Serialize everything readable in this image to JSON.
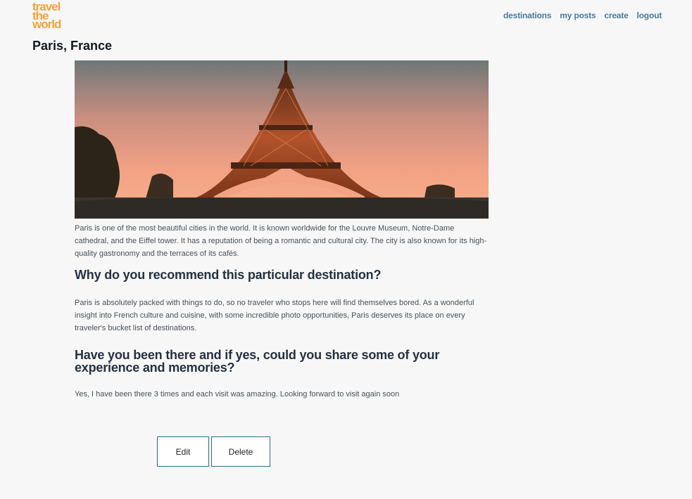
{
  "logo": {
    "line1": "travel",
    "line2": "the",
    "line3": "world"
  },
  "nav": {
    "destinations": "destinations",
    "my_posts": "my posts",
    "create": "create",
    "logout": "logout"
  },
  "post": {
    "title": "Paris, France",
    "description": "Paris is one of the most beautiful cities in the world. It is known worldwide for the Louvre Museum, Notre-Dame cathedral, and the Eiffel tower. It has a reputation of being a romantic and cultural city. The city is also known for its high-quality gastronomy and the terraces of its cafés.",
    "question1": "Why do you recommend this particular destination?",
    "answer1": "Paris is absolutely packed with things to do, so no traveler who stops here will find themselves bored. As a wonderful insight into French culture and cuisine, with some incredible photo opportunities, Paris deserves its place on every traveler's bucket list of destinations.",
    "question2": "Have you been there and if yes, could you share some of your experience and memories?",
    "answer2": "Yes, I have been there 3 times and each visit was amazing. Looking forward to visit again soon"
  },
  "actions": {
    "edit_label": "Edit",
    "delete_label": "Delete"
  },
  "colors": {
    "logo": "#f2a33a",
    "nav_link": "#4a7aa3",
    "button_border": "#2a6e86",
    "background": "#f7f7f7"
  }
}
